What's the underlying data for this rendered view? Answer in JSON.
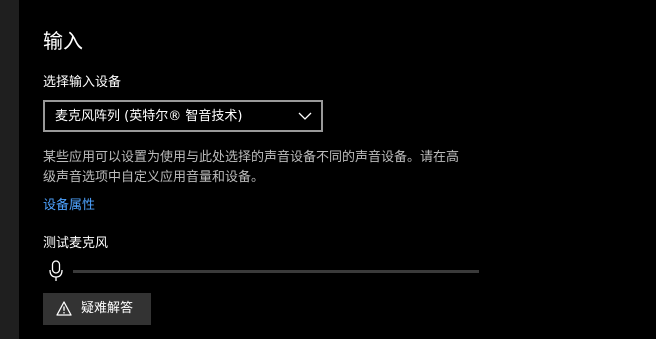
{
  "input_section": {
    "title": "输入",
    "device_label": "选择输入设备",
    "device_select": {
      "selected": "麦克风阵列 (英特尔® 智音技术)"
    },
    "description_lines": [
      "某些应用可以设置为使用与此处选择的声音设备不同的声音设备。请在高",
      "级声音选项中自定义应用音量和设备。"
    ],
    "device_properties_link": "设备属性",
    "mic_test": {
      "label": "测试麦克风",
      "level_fraction": 0
    },
    "troubleshoot_button": "疑难解答"
  },
  "icons": {
    "dropdown": "chevron-down-icon",
    "microphone": "microphone-icon",
    "troubleshoot": "warning-icon"
  },
  "colors": {
    "background": "#000000",
    "side_strip": "#1f1f1f",
    "link": "#4ea3ff",
    "description_text": "#bcbcbc",
    "select_border": "#999999",
    "button_bg": "#333333",
    "level_track": "#3a3a3a"
  }
}
